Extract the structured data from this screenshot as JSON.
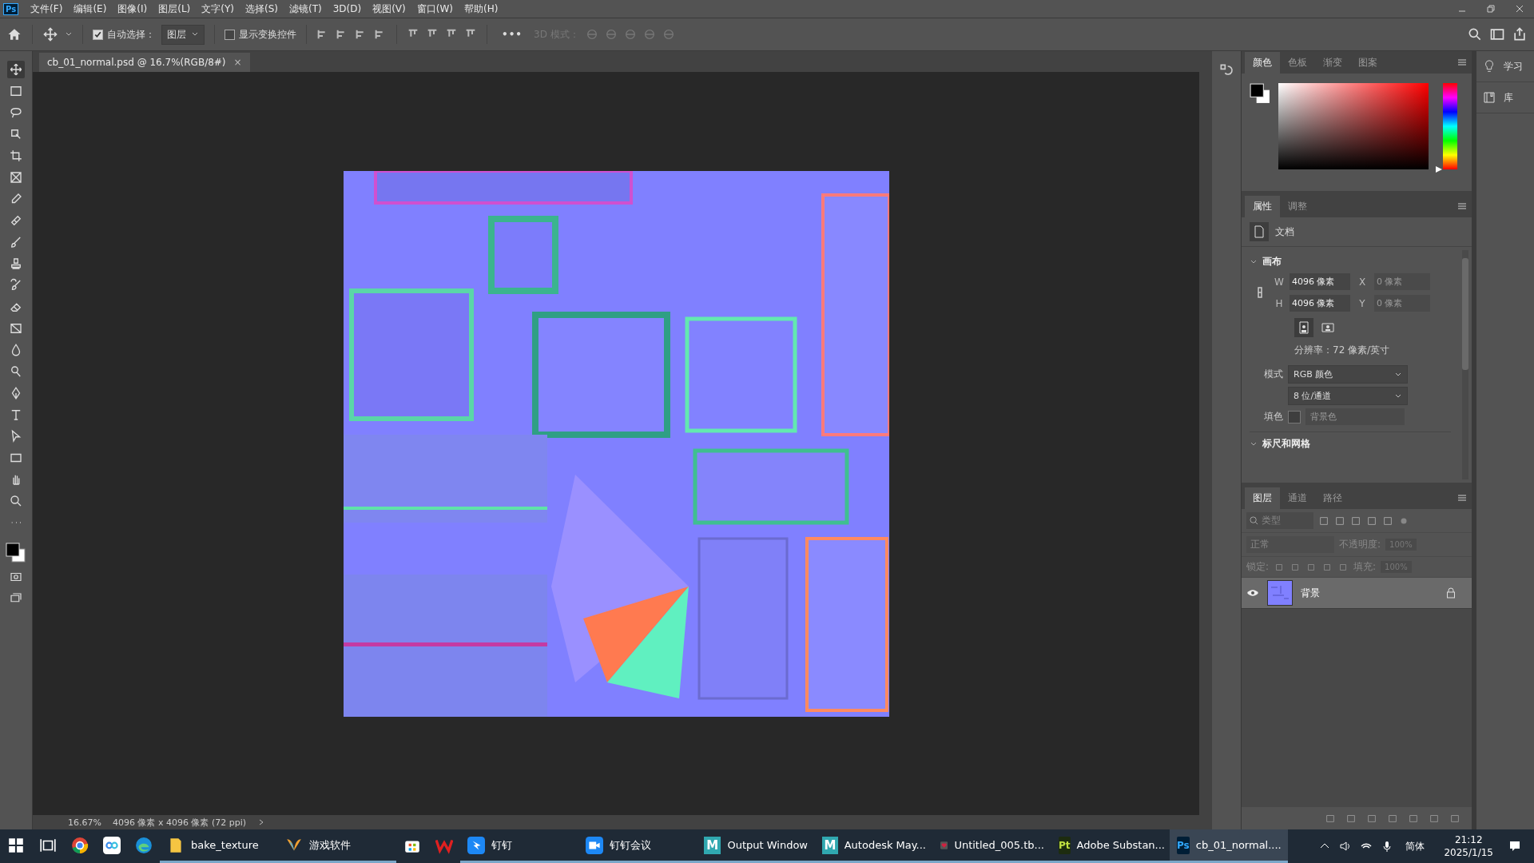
{
  "app_icon": "Ps",
  "menu": [
    "文件(F)",
    "编辑(E)",
    "图像(I)",
    "图层(L)",
    "文字(Y)",
    "选择(S)",
    "滤镜(T)",
    "3D(D)",
    "视图(V)",
    "窗口(W)",
    "帮助(H)"
  ],
  "options_bar": {
    "auto_select": {
      "label": "自动选择：",
      "checked": true
    },
    "auto_select_target": "图层",
    "show_transform": {
      "label": "显示变换控件",
      "checked": false
    },
    "more": "•••",
    "mode_3d_label": "3D 模式："
  },
  "document_tab": {
    "title": "cb_01_normal.psd @ 16.7%(RGB/8#)",
    "close": "×"
  },
  "color_panel": {
    "hue_slider": {
      "level": 0
    },
    "tabs": [
      {
        "label": "颜色",
        "selected": true
      },
      {
        "label": "色板",
        "selected": false
      },
      {
        "label": "渐变",
        "selected": false
      },
      {
        "label": "图案",
        "selected": false
      }
    ]
  },
  "properties_panel": {
    "tabs": [
      {
        "label": "属性",
        "selected": true
      },
      {
        "label": "调整",
        "selected": false
      }
    ],
    "type_label": "文档",
    "sections": [
      {
        "title": "画布",
        "expanded": true
      },
      {
        "title": "标尺和网格",
        "expanded": true
      }
    ],
    "width_label": "W",
    "width": "4096 像素",
    "x_label": "X",
    "x_value": "0 像素",
    "height_label": "H",
    "height": "4096 像素",
    "y_label": "Y",
    "y_value": "0 像素",
    "resolution": "分辨率：72 像素/英寸",
    "mode_label": "模式",
    "mode": "RGB 颜色",
    "depth": "8 位/通道",
    "fill_label": "填色",
    "fill": "背景色"
  },
  "layers_panel": {
    "tabs": [
      {
        "label": "图层",
        "selected": true
      },
      {
        "label": "通道",
        "selected": false
      },
      {
        "label": "路径",
        "selected": false
      }
    ],
    "filter_placeholder": "类型",
    "blend_mode": "正常",
    "opacity_label": "不透明度:",
    "opacity": "100%",
    "lock_label": "锁定:",
    "fill_label": "填充:",
    "fill": "100%",
    "layers": [
      {
        "name": "背景",
        "visible": true,
        "locked": true,
        "selected": true
      }
    ]
  },
  "side_panels": [
    {
      "label": "学习",
      "kind": "learn"
    },
    {
      "label": "库",
      "kind": "library"
    }
  ],
  "status_bar": {
    "zoom": "16.67%",
    "info": "4096 像素 x 4096 像素 (72 ppi)"
  },
  "taskbar": {
    "items": [
      {
        "kind": "windows",
        "running": false,
        "selected": false
      },
      {
        "kind": "taskview",
        "running": false,
        "selected": false
      },
      {
        "kind": "chrome",
        "running": false,
        "selected": false
      },
      {
        "kind": "cloud",
        "running": false,
        "selected": false
      },
      {
        "kind": "edge",
        "running": false,
        "selected": false
      },
      {
        "kind": "folder",
        "label": "bake_texture",
        "running": true,
        "selected": false
      },
      {
        "kind": "butterfly",
        "label": "游戏软件",
        "running": true,
        "selected": false
      },
      {
        "kind": "store",
        "running": false,
        "selected": false
      },
      {
        "kind": "wps",
        "running": false,
        "selected": false
      },
      {
        "kind": "dingtalk",
        "label": "钉钉",
        "running": true,
        "selected": false
      },
      {
        "kind": "meeting",
        "label": "钉钉会议",
        "running": true,
        "selected": false
      },
      {
        "kind": "letter",
        "icon_text": "M",
        "label": "Output Window",
        "running": true,
        "selected": false
      },
      {
        "kind": "letter",
        "icon_text": "M",
        "label": "Autodesk May...",
        "running": true,
        "selected": false
      },
      {
        "kind": "heart",
        "label": "Untitled_005.tb...",
        "running": true,
        "selected": false
      },
      {
        "kind": "badge",
        "icon_text": "Pt",
        "label": "Adobe Substan...",
        "running": true,
        "selected": false
      },
      {
        "kind": "badge",
        "icon_text": "Ps",
        "label": "cb_01_normal....",
        "running": true,
        "selected": true
      }
    ],
    "ime": "简体",
    "time": "21:12",
    "date": "2025/1/15"
  }
}
